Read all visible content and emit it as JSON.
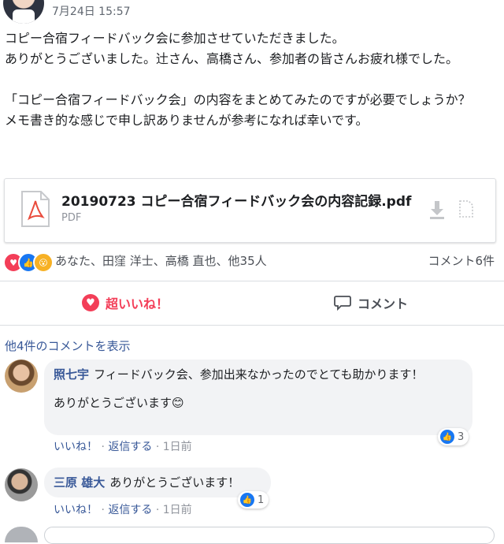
{
  "post": {
    "timestamp": "7月24日 15:57",
    "paragraphs": [
      "コピー合宿フィードバック会に参加させていただきました。\nありがとうございました。辻さん、高橋さん、参加者の皆さんお疲れ様でした。",
      "「コピー合宿フィードバック会」の内容をまとめてみたのですが必要でしょうか？\nメモ書き的な感じで申し訳ありませんが参考になれば幸いです。"
    ],
    "attachment": {
      "name": "20190723 コピー合宿フィードバック会の内容記録.pdf",
      "type": "PDF"
    },
    "reactions_summary": "あなた、田窪 洋士、高橋 直也、他35人",
    "comment_count": "コメント6件",
    "actions": {
      "love": "超いいね！",
      "comment": "コメント"
    }
  },
  "more_comments": "他4件のコメントを表示",
  "comments": [
    {
      "author": "照七宇",
      "text1": "フィードバック会、参加出来なかったのでとても助かります！",
      "text2": "ありがとうございます😊",
      "reaction_count": "3",
      "like": "いいね！",
      "reply": "返信する",
      "time": "1日前"
    },
    {
      "author": "三原 雄大",
      "text1": "ありがとうございます！",
      "reaction_count": "1",
      "like": "いいね！",
      "reply": "返信する",
      "time": "1日前"
    }
  ],
  "colors": {
    "link": "#385898",
    "love": "#f33e58",
    "like": "#1877f2",
    "wow": "#f7b125"
  }
}
